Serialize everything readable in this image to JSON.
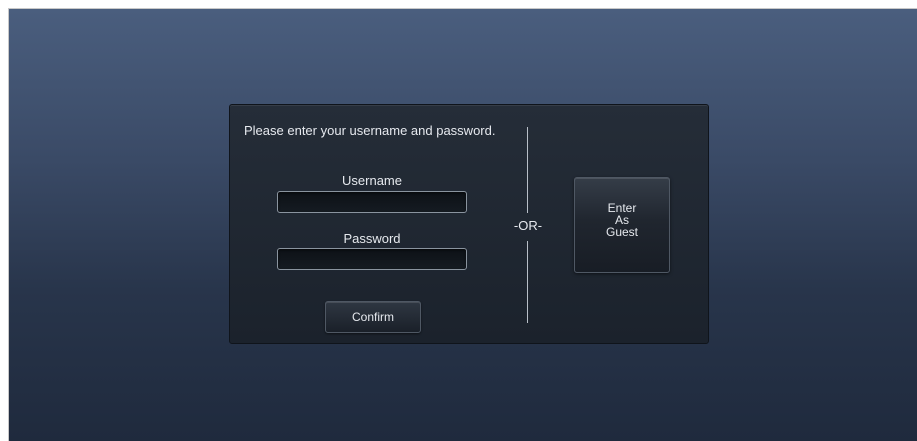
{
  "login": {
    "prompt": "Please enter your username and password.",
    "username_label": "Username",
    "username_value": "",
    "password_label": "Password",
    "password_value": "",
    "confirm_label": "Confirm",
    "separator_label": "-OR-",
    "guest_label": "Enter\nAs\nGuest"
  },
  "colors": {
    "background_top": "#4a5e7e",
    "background_bottom": "#1f2a3d",
    "panel": "#1f2630",
    "text": "#e6e9ee"
  }
}
